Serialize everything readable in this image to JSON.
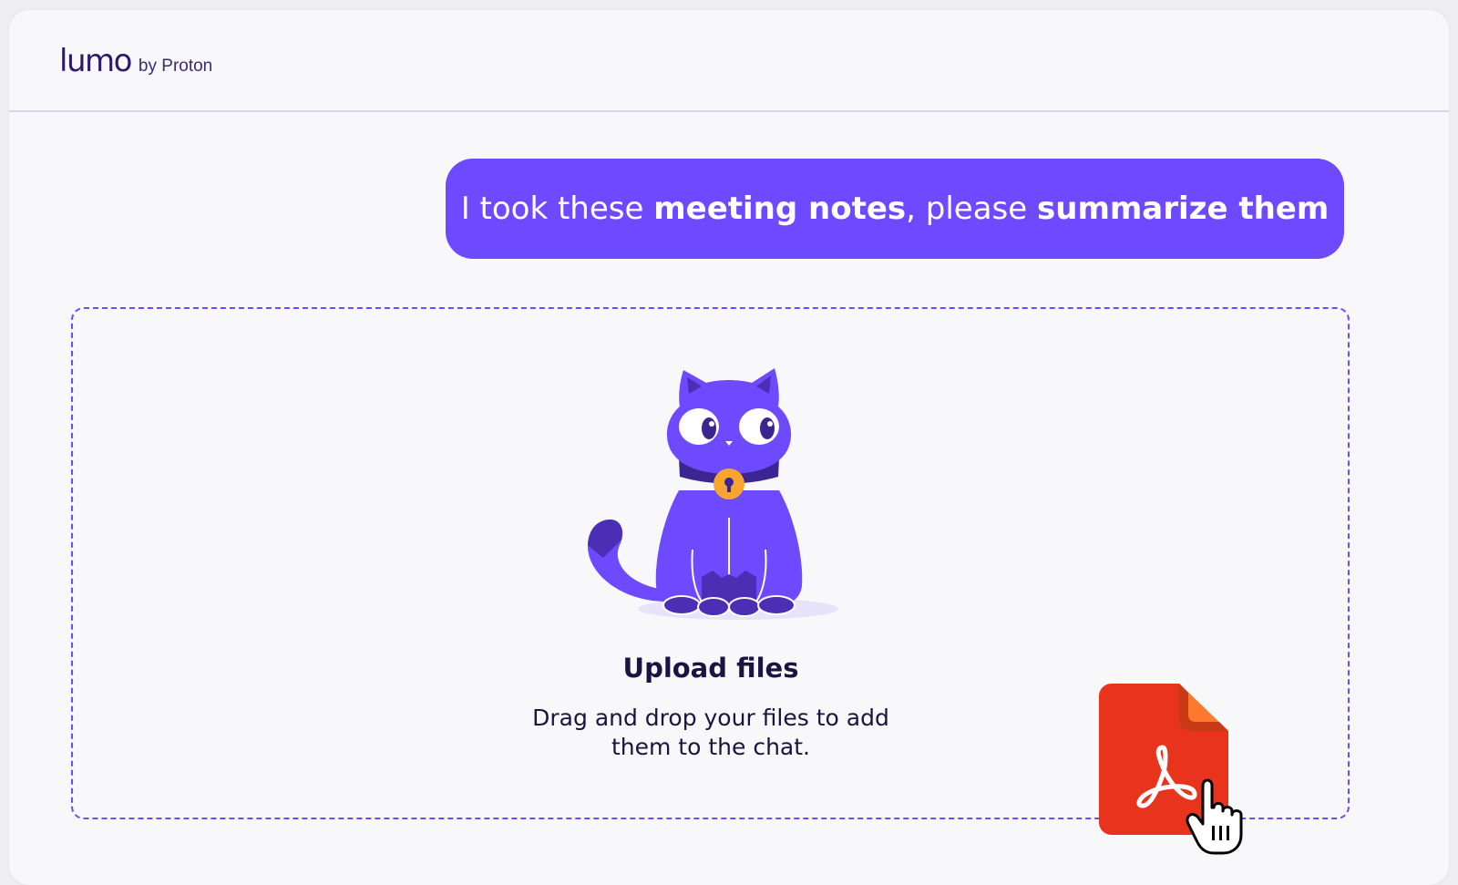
{
  "header": {
    "logo_word": "lumo",
    "logo_by": "by Proton"
  },
  "message": {
    "part1": "I took these ",
    "bold1": "meeting notes",
    "part2": ", please ",
    "bold2": "summarize them"
  },
  "dropzone": {
    "title": "Upload files",
    "description": "Drag and drop your files to add them to the chat."
  },
  "colors": {
    "accent": "#6d4aff",
    "text_dark": "#1b1340",
    "pdf_red": "#e8341c",
    "pdf_fold": "#ff7a2e"
  },
  "icons": [
    "lumo-cat-mascot",
    "pdf-file-icon",
    "hand-cursor-icon"
  ]
}
